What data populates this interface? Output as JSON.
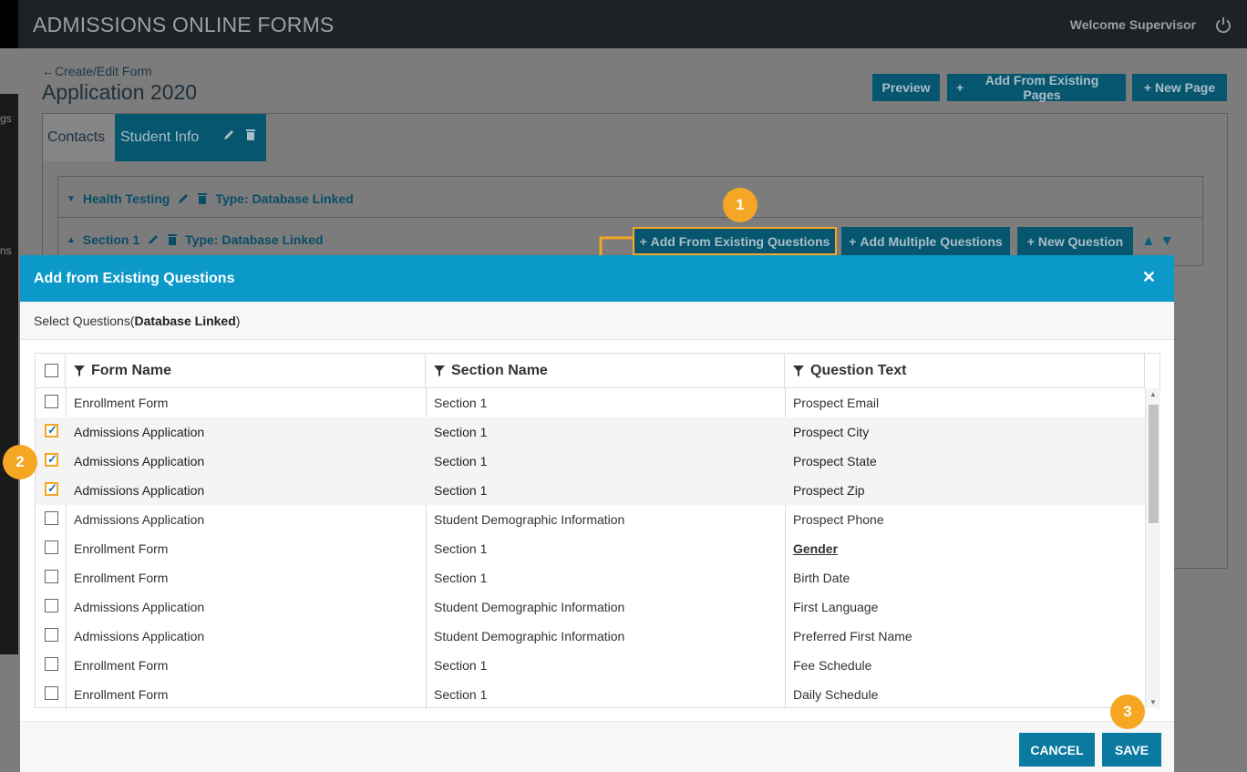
{
  "topbar": {
    "app_title": "ADMISSIONS ONLINE FORMS",
    "welcome": "Welcome Supervisor"
  },
  "sidebar": {
    "frag1": "gs",
    "frag2": "ns"
  },
  "page": {
    "breadcrumb": "Create/Edit Form",
    "title": "Application 2020",
    "buttons": {
      "preview": "Preview",
      "add_existing_pages": "Add From Existing Pages",
      "new_page": "New Page"
    },
    "tabs": [
      "Contacts",
      "Student Info"
    ],
    "sections": [
      {
        "name": "Health Testing",
        "type": "Type: Database Linked"
      },
      {
        "name": "Section 1",
        "type": "Type: Database Linked"
      }
    ],
    "section_buttons": {
      "add_existing_questions": "Add From Existing Questions",
      "add_multiple": "Add Multiple Questions",
      "new_question": "New Question"
    }
  },
  "callouts": [
    "1",
    "2",
    "3"
  ],
  "modal": {
    "title": "Add from Existing Questions",
    "subtitle_prefix": "Select Questions(",
    "subtitle_bold": "Database Linked",
    "subtitle_suffix": ")",
    "columns": [
      "Form Name",
      "Section Name",
      "Question Text"
    ],
    "rows": [
      {
        "form": "Enrollment Form",
        "section": "Section 1",
        "question": "Prospect Email",
        "checked": false
      },
      {
        "form": "Admissions Application",
        "section": "Section 1",
        "question": "Prospect City",
        "checked": true
      },
      {
        "form": "Admissions Application",
        "section": "Section 1",
        "question": "Prospect State",
        "checked": true
      },
      {
        "form": "Admissions Application",
        "section": "Section 1",
        "question": "Prospect Zip",
        "checked": true
      },
      {
        "form": "Admissions Application",
        "section": "Student Demographic Information",
        "question": "Prospect Phone",
        "checked": false
      },
      {
        "form": "Enrollment Form",
        "section": "Section 1",
        "question": "Gender",
        "checked": false
      },
      {
        "form": "Enrollment Form",
        "section": "Section 1",
        "question": "Birth Date",
        "checked": false
      },
      {
        "form": "Admissions Application",
        "section": "Student Demographic Information",
        "question": "First Language",
        "checked": false
      },
      {
        "form": "Admissions Application",
        "section": "Student Demographic Information",
        "question": "Preferred First Name",
        "checked": false
      },
      {
        "form": "Enrollment Form",
        "section": "Section 1",
        "question": "Fee Schedule",
        "checked": false
      },
      {
        "form": "Enrollment Form",
        "section": "Section 1",
        "question": "Daily Schedule",
        "checked": false
      }
    ],
    "cancel_label": "CANCEL",
    "save_label": "SAVE"
  },
  "colors": {
    "accent": "#0b99c9",
    "button": "#0b7aa0",
    "callout": "#f5a623",
    "topbar": "#1e2126"
  }
}
